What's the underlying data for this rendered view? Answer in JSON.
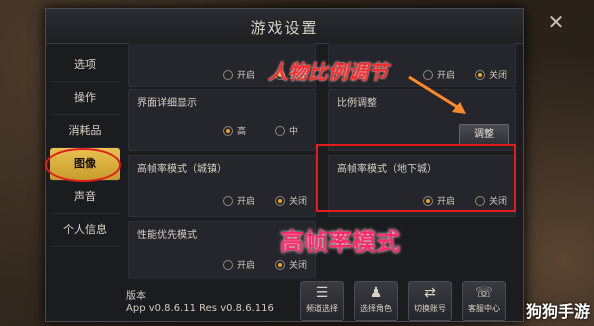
{
  "window": {
    "title": "游戏设置",
    "close_glyph": "✕"
  },
  "sidebar": {
    "items": [
      {
        "label": "选项"
      },
      {
        "label": "操作"
      },
      {
        "label": "消耗品"
      },
      {
        "label": "图像",
        "active": true
      },
      {
        "label": "声音"
      },
      {
        "label": "个人信息"
      }
    ]
  },
  "settings": {
    "row0_left": {
      "label": "",
      "opt1": "开启",
      "opt2": "关闭",
      "selected": "关闭"
    },
    "row0_right": {
      "label": "",
      "opt1": "开启",
      "opt2": "关闭",
      "selected": "关闭"
    },
    "ui_detail": {
      "label": "界面详细显示",
      "opt1": "高",
      "opt2": "中",
      "selected": "高"
    },
    "scale": {
      "label": "比例调整",
      "button": "调整"
    },
    "hfr_town": {
      "label": "高帧率模式（城镇）",
      "opt1": "开启",
      "opt2": "关闭",
      "selected": "关闭"
    },
    "hfr_dungeon": {
      "label": "高帧率模式（地下城）",
      "opt1": "开启",
      "opt2": "关闭",
      "selected": "开启"
    },
    "performance": {
      "label": "性能优先模式",
      "opt1": "开启",
      "opt2": "关闭",
      "selected": "关闭"
    }
  },
  "footer": {
    "version_label": "版本",
    "version_value": "App v0.8.6.11 Res v0.8.6.116",
    "buttons": [
      {
        "label": "频道选择",
        "icon": "list-icon"
      },
      {
        "label": "选择角色",
        "icon": "character-icon"
      },
      {
        "label": "切换账号",
        "icon": "switch-account-icon"
      },
      {
        "label": "客服中心",
        "icon": "support-icon"
      }
    ]
  },
  "annotations": {
    "scale_note": "人物比例调节",
    "hfr_note": "高帧率模式"
  },
  "watermark": "狗狗手游",
  "colors": {
    "accent": "#e9c252",
    "annotation": "#e31b1b",
    "radio_on": "#f0a020"
  }
}
